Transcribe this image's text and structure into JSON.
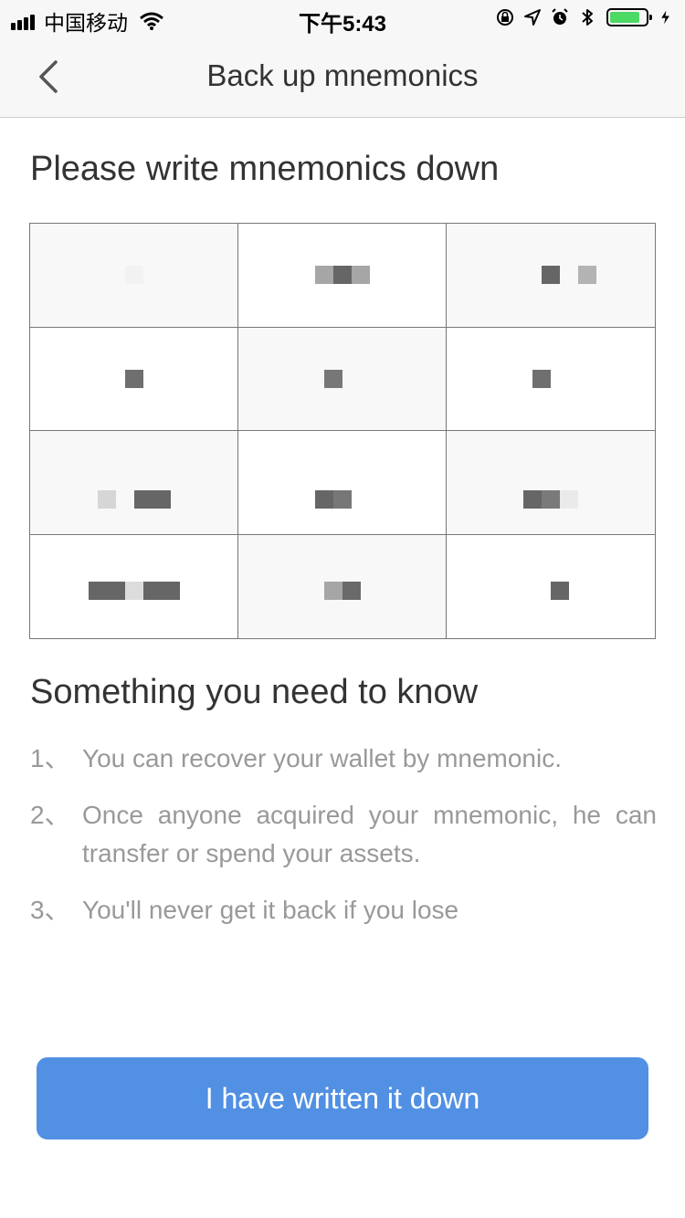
{
  "status_bar": {
    "carrier": "中国移动",
    "time": "下午5:43",
    "battery_level": 0.85,
    "icons": [
      "signal-icon",
      "wifi-icon",
      "orientation-lock-icon",
      "location-icon",
      "alarm-icon",
      "bluetooth-icon",
      "battery-icon",
      "charging-icon"
    ]
  },
  "nav": {
    "back_icon": "chevron-left-icon",
    "title": "Back up mnemonics"
  },
  "main": {
    "heading": "Please write mnemonics down",
    "mnemonic_grid": {
      "rows": 4,
      "columns": 3,
      "words": [
        "",
        "",
        "",
        "",
        "",
        "",
        "",
        "",
        "",
        "",
        "",
        ""
      ]
    },
    "notice_heading": "Something you need to know",
    "notices": [
      {
        "num": "1、",
        "text": "You can recover your wallet by mnemonic."
      },
      {
        "num": "2、",
        "text": "Once anyone acquired your mnemonic, he can transfer or spend your assets."
      },
      {
        "num": "3、",
        "text": "You'll never get it back if you lose"
      }
    ],
    "confirm_button": "I have written it down"
  },
  "colors": {
    "accent": "#5190e3",
    "nav_background": "#f7f7f7",
    "battery_fill": "#4cd964",
    "muted_text": "#999999",
    "title_text": "#333333"
  }
}
